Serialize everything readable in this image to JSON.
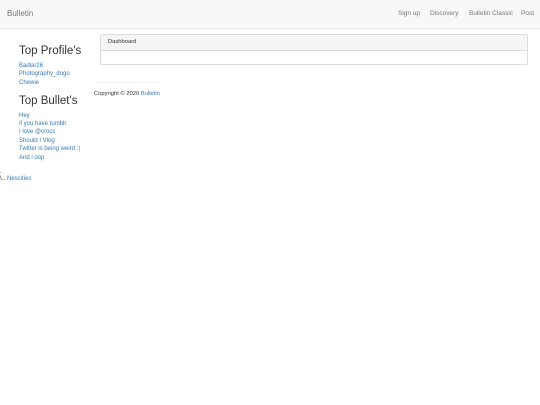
{
  "navbar": {
    "brand": "Bulletin",
    "links": [
      "Sign up",
      "Discovery",
      "Bulletin Classic",
      "Post"
    ]
  },
  "sidebar": {
    "top_profiles": {
      "heading": "Top Profile's",
      "items": [
        "Badlar26",
        "Photography_dogo",
        "Chewie"
      ]
    },
    "top_bullets": {
      "heading": "Top Bullet's",
      "items": [
        "Hey",
        "if you have tumblr",
        "I love @crocs",
        "Should I Vlog",
        "Twitter is being weird :|",
        "And i oop"
      ]
    }
  },
  "panel": {
    "heading": "Dashboard"
  },
  "footer": {
    "copyright": "Copyright © 2020",
    "brand_link": "Bulletin"
  },
  "stray": {
    "mark": ".",
    "prefix": "\\..",
    "link": "Nescities"
  },
  "colors": {
    "link": "#337ab7",
    "navbar_bg": "#f8f8f8",
    "nav_text": "#777777"
  }
}
